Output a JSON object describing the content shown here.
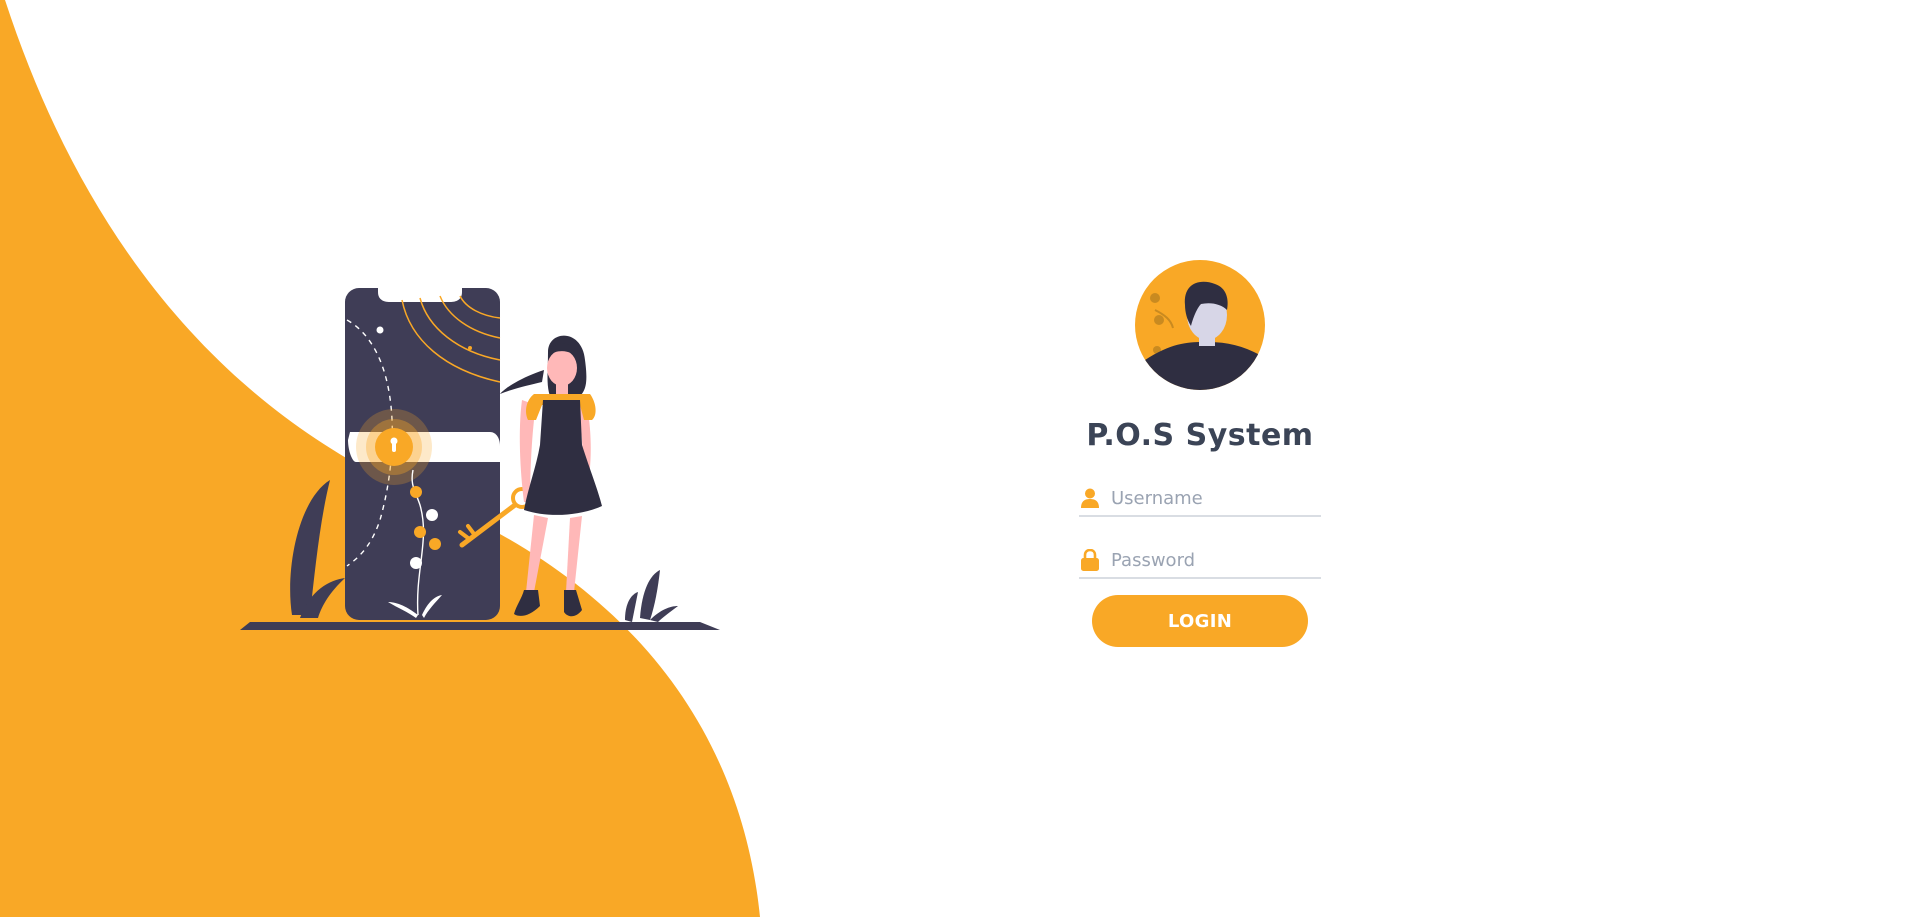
{
  "app": {
    "title": "P.O.S System"
  },
  "colors": {
    "accent": "#f9a826",
    "dark": "#3f3d56",
    "text": "#3b4456",
    "placeholder": "#9aa3b2",
    "skin": "#ffb8b8"
  },
  "login": {
    "username": {
      "icon": "user-icon",
      "placeholder": "Username",
      "value": ""
    },
    "password": {
      "icon": "lock-icon",
      "placeholder": "Password",
      "value": ""
    },
    "submit_label": "LOGIN"
  }
}
